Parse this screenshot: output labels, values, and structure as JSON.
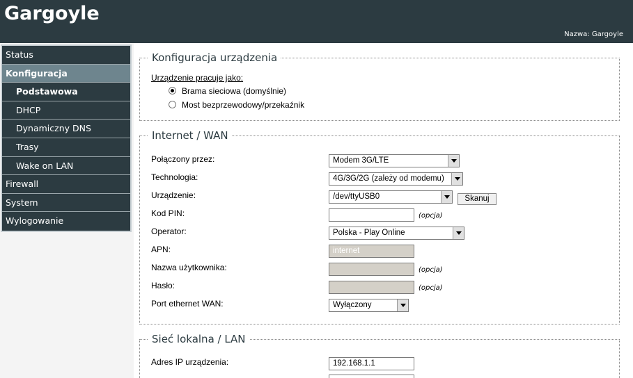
{
  "header": {
    "brand": "Gargoyle",
    "hostname": "Nazwa: Gargoyle"
  },
  "nav": [
    {
      "label": "Status"
    },
    {
      "label": "Konfiguracja"
    },
    {
      "label": "Podstawowa"
    },
    {
      "label": "DHCP"
    },
    {
      "label": "Dynamiczny DNS"
    },
    {
      "label": "Trasy"
    },
    {
      "label": "Wake on LAN"
    },
    {
      "label": "Firewall"
    },
    {
      "label": "System"
    },
    {
      "label": "Wylogowanie"
    }
  ],
  "device": {
    "legend": "Konfiguracja urządzenia",
    "mode_label": "Urządzenie pracuje jako:",
    "options": [
      "Brama sieciowa (domyślnie)",
      "Most bezprzewodowy/przekaźnik"
    ],
    "selected": "Brama sieciowa (domyślnie)"
  },
  "wan": {
    "legend": "Internet / WAN",
    "connected_via_label": "Połączony przez:",
    "connected_via_value": "Modem 3G/LTE",
    "technology_label": "Technologia:",
    "technology_value": "4G/3G/2G (zależy od modemu)",
    "device_label": "Urządzenie:",
    "device_value": "/dev/ttyUSB0",
    "scan_button": "Skanuj",
    "pin_label": "Kod PIN:",
    "pin_value": "",
    "optional": "(opcja)",
    "operator_label": "Operator:",
    "operator_value": "Polska - Play Online",
    "apn_label": "APN:",
    "apn_value": "internet",
    "username_label": "Nazwa użytkownika:",
    "username_value": "",
    "password_label": "Hasło:",
    "password_value": "",
    "port_label": "Port ethernet WAN:",
    "port_value": "Wyłączony"
  },
  "lan": {
    "legend": "Sieć lokalna / LAN",
    "ip_label": "Adres IP urządzenia:",
    "ip_value": "192.168.1.1"
  }
}
